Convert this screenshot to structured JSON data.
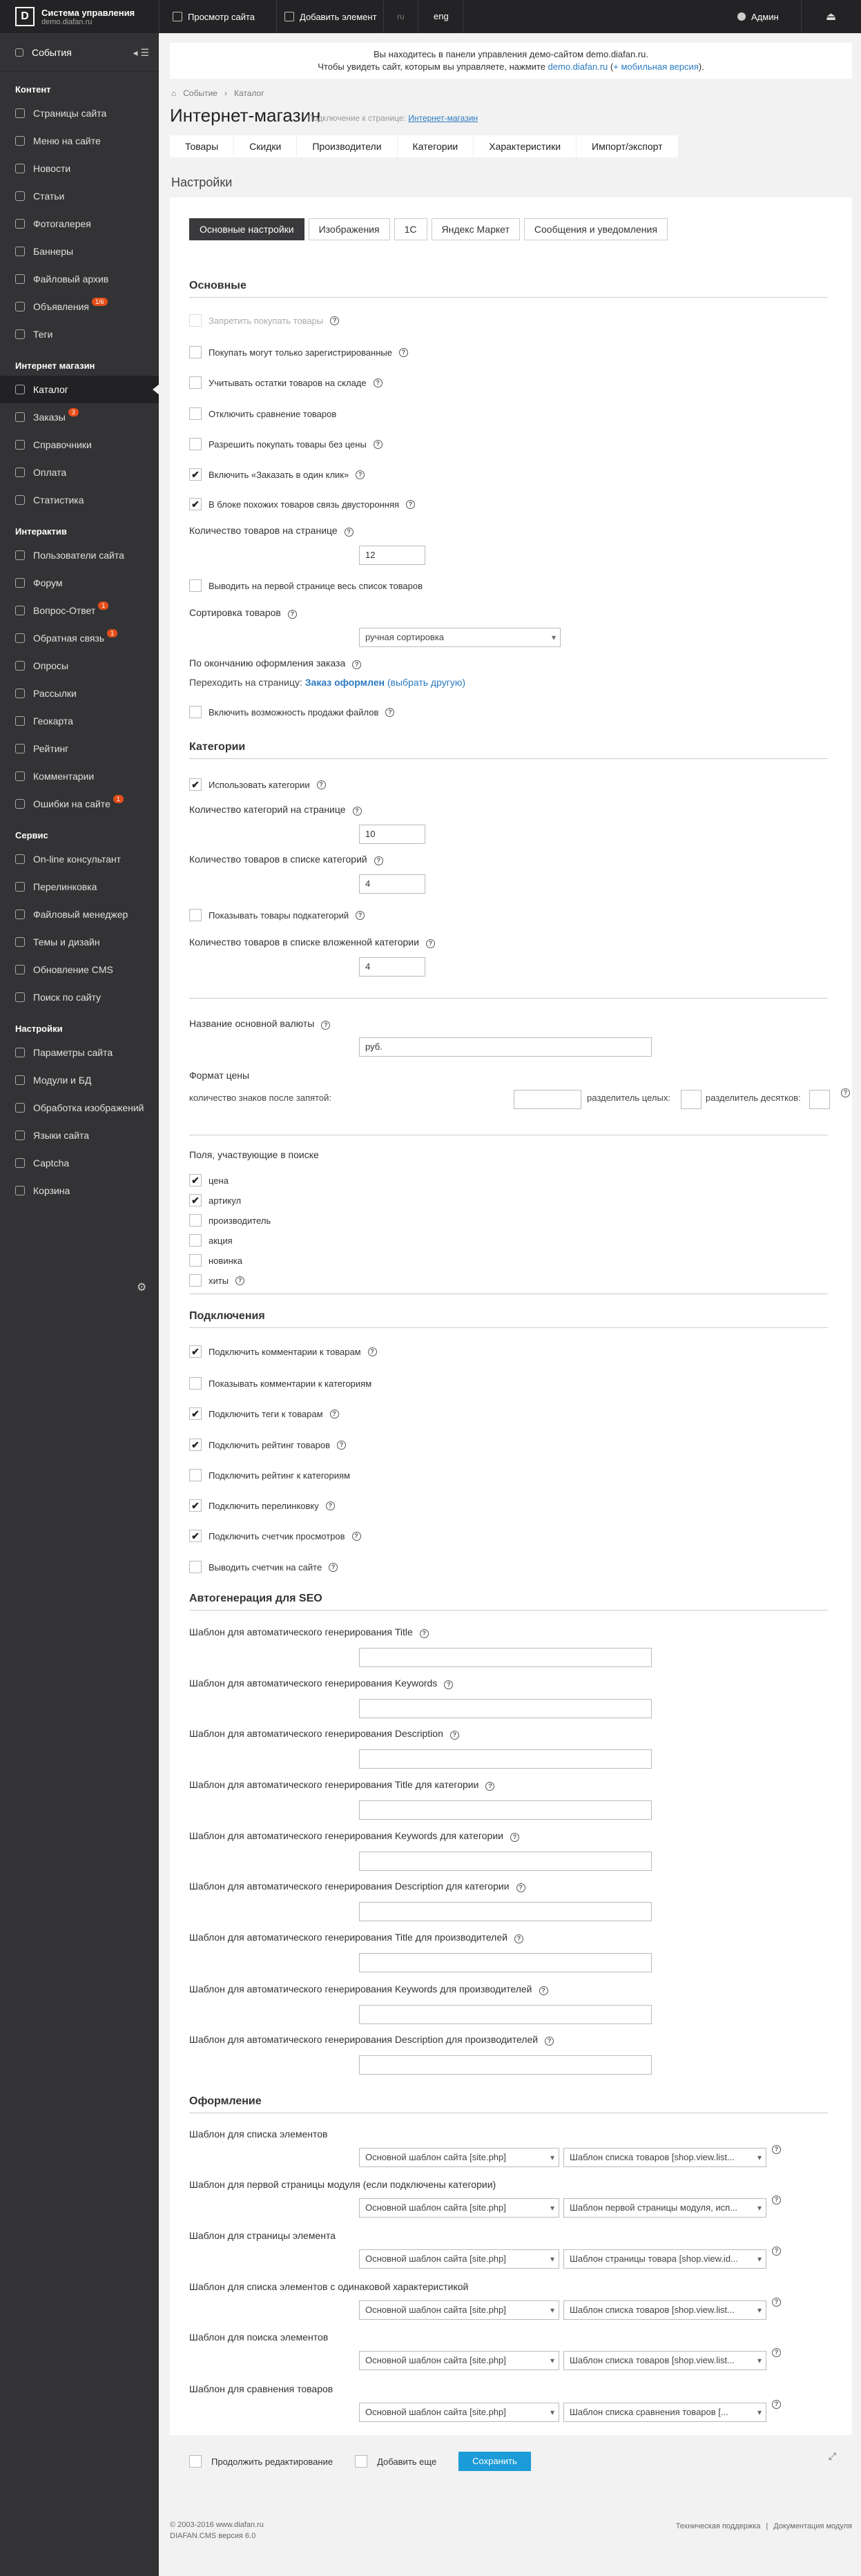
{
  "top": {
    "logo_mark": "D",
    "title": "Система управления",
    "domain": "demo.diafan.ru",
    "view_site": "Просмотр сайта",
    "add_element": "Добавить элемент",
    "lang_ru": "ru",
    "lang_en": "eng",
    "user": "Админ"
  },
  "sidebar": {
    "events": "События",
    "sections": [
      {
        "title": "Контент",
        "items": [
          "Страницы сайта",
          "Меню на сайте",
          "Новости",
          "Статьи",
          "Фотогалерея",
          "Баннеры",
          "Файловый архив",
          "Объявления",
          "Теги"
        ],
        "badges": {
          "7": "1/6"
        }
      },
      {
        "title": "Интернет магазин",
        "items": [
          "Каталог",
          "Заказы",
          "Справочники",
          "Оплата",
          "Статистика"
        ],
        "badges": {
          "1": "3"
        }
      },
      {
        "title": "Интерактив",
        "items": [
          "Пользователи сайта",
          "Форум",
          "Вопрос-Ответ",
          "Обратная связь",
          "Опросы",
          "Рассылки",
          "Геокарта",
          "Рейтинг",
          "Комментарии",
          "Ошибки на сайте"
        ],
        "badges": {
          "2": "1",
          "3": "1",
          "9": "1"
        }
      },
      {
        "title": "Сервис",
        "items": [
          "On-line консультант",
          "Перелинковка",
          "Файловый менеджер",
          "Темы и дизайн",
          "Обновление CMS",
          "Поиск по сайту"
        ],
        "badges": {}
      },
      {
        "title": "Настройки",
        "items": [
          "Параметры сайта",
          "Модули и БД",
          "Обработка изображений",
          "Языки сайта",
          "Captcha",
          "Корзина"
        ],
        "badges": {}
      }
    ]
  },
  "notice": {
    "line1": "Вы находитесь в панели управления демо-сайтом demo.diafan.ru.",
    "line2_pre": "Чтобы увидеть сайт, которым вы управляете, нажмите ",
    "link1": "demo.diafan.ru",
    "mid": " (",
    "link2": "+ мобильная версия",
    "end": ")."
  },
  "crumb": {
    "home": "Событие",
    "sep": "›",
    "current": "Каталог"
  },
  "page": {
    "title": "Интернет-магазин",
    "conn_pre": "Подключение к странице: ",
    "conn_link": "Интернет-магазин"
  },
  "tabs": [
    "Товары",
    "Скидки",
    "Производители",
    "Категории",
    "Характеристики",
    "Импорт/экспорт"
  ],
  "settings_title": "Настройки",
  "subtabs": [
    "Основные настройки",
    "Изображения",
    "1С",
    "Яндекс Маркет",
    "Сообщения и уведомления"
  ],
  "basic": {
    "title": "Основные",
    "c1": "Запретить покупать товары",
    "c2": "Покупать могут только зарегистрированные",
    "c3": "Учитывать остатки товаров на складе",
    "c4": "Отключить сравнение товаров",
    "c5": "Разрешить покупать товары без цены",
    "c6": "Включить «Заказать в один клик»",
    "c7": "В блоке похожих товаров связь двусторонняя",
    "per_page_label": "Количество товаров на странице",
    "per_page": "12",
    "c8": "Выводить на первой странице весь список товаров",
    "sort_label": "Сортировка товаров",
    "sort_value": "ручная сортировка",
    "after_order_label": "По окончанию оформления заказа",
    "after_order_pre": "Переходить на страницу: ",
    "after_order_link": "Заказ оформлен",
    "after_order_other": " (выбрать другую)",
    "c9": "Включить возможность продажи файлов"
  },
  "categories": {
    "title": "Категории",
    "c1": "Использовать категории",
    "l1": "Количество категорий на странице",
    "v1": "10",
    "l2": "Количество товаров в списке категорий",
    "v2": "4",
    "c2": "Показывать товары подкатегорий",
    "l3": "Количество товаров в списке вложенной категории",
    "v3": "4"
  },
  "currency": {
    "label": "Название основной валюты",
    "value": "руб.",
    "format_label": "Формат цены",
    "decimals": "количество знаков после запятой:",
    "sep_int": "разделитель целых:",
    "sep_dec": "разделитель десятков:"
  },
  "search": {
    "title": "Поля, участвующие в поиске",
    "items": [
      "цена",
      "артикул",
      "производитель",
      "акция",
      "новинка",
      "хиты"
    ]
  },
  "connections": {
    "title": "Подключения",
    "items": [
      "Подключить комментарии к товарам",
      "Показывать комментарии к категориям",
      "Подключить теги к товарам",
      "Подключить рейтинг товаров",
      "Подключить рейтинг к категориям",
      "Подключить перелинковку",
      "Подключить счетчик просмотров",
      "Выводить счетчик на сайте"
    ]
  },
  "seo": {
    "title": "Автогенерация для SEO",
    "items": [
      "Шаблон для автоматического генерирования Title",
      "Шаблон для автоматического генерирования Keywords",
      "Шаблон для автоматического генерирования Description",
      "Шаблон для автоматического генерирования Title для категории",
      "Шаблон для автоматического генерирования Keywords для категории",
      "Шаблон для автоматического генерирования Description для категории",
      "Шаблон для автоматического генерирования Title для производителей",
      "Шаблон для автоматического генерирования Keywords для производителей",
      "Шаблон для автоматического генерирования Description для производителей"
    ]
  },
  "design": {
    "title": "Оформление",
    "rows": [
      {
        "label": "Шаблон для списка элементов",
        "a": "Основной шаблон сайта [site.php]",
        "b": "Шаблон списка товаров [shop.view.list..."
      },
      {
        "label": "Шаблон для первой страницы модуля (если подключены категории)",
        "a": "Основной шаблон сайта [site.php]",
        "b": "Шаблон первой страницы модуля, исп..."
      },
      {
        "label": "Шаблон для страницы элемента",
        "a": "Основной шаблон сайта [site.php]",
        "b": "Шаблон страницы товара [shop.view.id..."
      },
      {
        "label": "Шаблон для списка элементов с одинаковой характеристикой",
        "a": "Основной шаблон сайта [site.php]",
        "b": "Шаблон списка товаров [shop.view.list..."
      },
      {
        "label": "Шаблон для поиска элементов",
        "a": "Основной шаблон сайта [site.php]",
        "b": "Шаблон списка товаров [shop.view.list..."
      },
      {
        "label": "Шаблон для сравнения товаров",
        "a": "Основной шаблон сайта [site.php]",
        "b": "Шаблон списка сравнения товаров [..."
      }
    ]
  },
  "bottom": {
    "continue": "Продолжить редактирование",
    "add_more": "Добавить еще",
    "save": "Сохранить"
  },
  "footer": {
    "copy": "© 2003-2016 www.diafan.ru",
    "version": "DIAFAN.CMS версия 6.0",
    "support": "Техническая поддержка",
    "sep": "|",
    "docs": "Документация модуля"
  }
}
